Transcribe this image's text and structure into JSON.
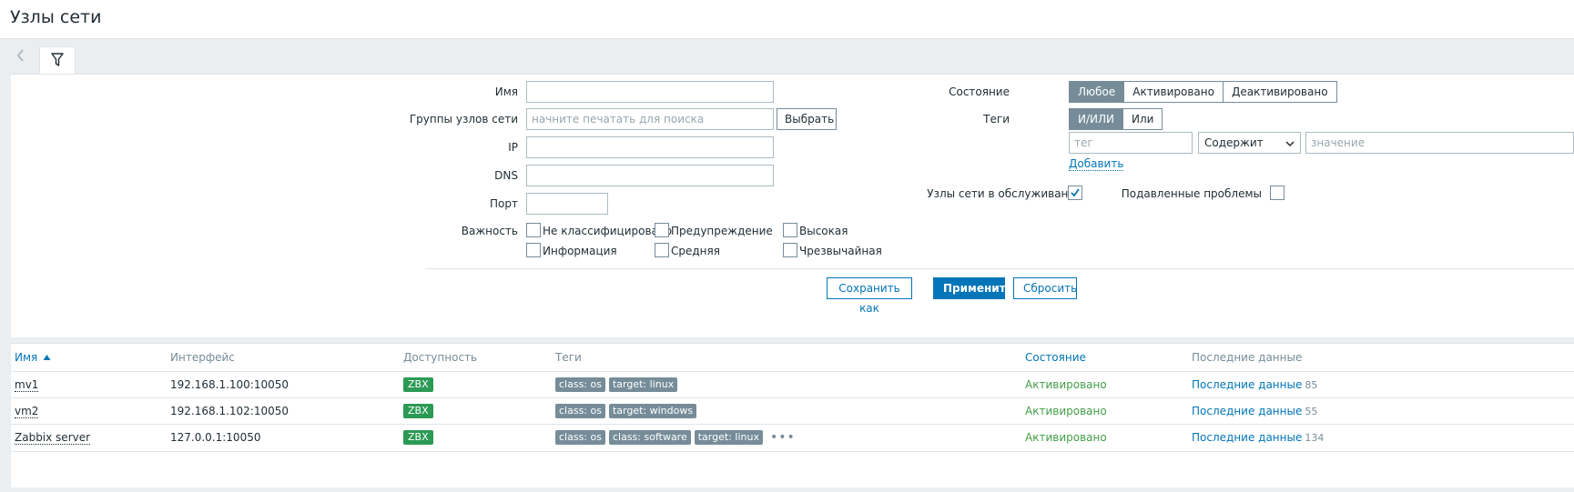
{
  "page": {
    "title": "Узлы сети"
  },
  "filter": {
    "name": {
      "label": "Имя",
      "value": ""
    },
    "host_groups": {
      "label": "Группы узлов сети",
      "placeholder": "начните печатать для поиска",
      "select_label": "Выбрать"
    },
    "ip": {
      "label": "IP",
      "value": ""
    },
    "dns": {
      "label": "DNS",
      "value": ""
    },
    "port": {
      "label": "Порт",
      "value": ""
    },
    "severity": {
      "label": "Важность",
      "options": [
        "Не классифицировано",
        "Предупреждение",
        "Высокая",
        "Информация",
        "Средняя",
        "Чрезвычайная"
      ]
    },
    "status": {
      "label": "Состояние",
      "options": [
        "Любое",
        "Активировано",
        "Деактивировано"
      ],
      "selected": "Любое"
    },
    "tags": {
      "label": "Теги",
      "operators": [
        "И/ИЛИ",
        "Или"
      ],
      "selected": "И/ИЛИ",
      "tag_placeholder": "тег",
      "operator_value": "Содержит",
      "value_placeholder": "значение",
      "add_label": "Добавить"
    },
    "maintenance": {
      "label": "Узлы сети в обслуживании",
      "checked": true
    },
    "suppressed": {
      "label": "Подавленные проблемы",
      "checked": false
    },
    "buttons": {
      "save_as": "Сохранить как",
      "apply": "Применить",
      "reset": "Сбросить"
    }
  },
  "table": {
    "columns": [
      "Имя",
      "Интерфейс",
      "Доступность",
      "Теги",
      "Состояние",
      "Последние данные"
    ],
    "sort_column": "Имя",
    "sort_direction": "asc",
    "rows": [
      {
        "name": "mv1",
        "interface": "192.168.1.100:10050",
        "availability": "ZBX",
        "tags": [
          "class: os",
          "target: linux"
        ],
        "status": "Активировано",
        "latest_label": "Последние данные",
        "latest_count": "85"
      },
      {
        "name": "vm2",
        "interface": "192.168.1.102:10050",
        "availability": "ZBX",
        "tags": [
          "class: os",
          "target: windows"
        ],
        "status": "Активировано",
        "latest_label": "Последние данные",
        "latest_count": "55"
      },
      {
        "name": "Zabbix server",
        "interface": "127.0.0.1:10050",
        "availability": "ZBX",
        "tags": [
          "class: os",
          "class: software",
          "target: linux"
        ],
        "status": "Активировано",
        "latest_label": "Последние данные",
        "latest_count": "134",
        "more_tags": "•••"
      }
    ]
  },
  "icons": {
    "back": "chevron-left-icon",
    "filter": "filter-funnel-icon",
    "select_caret": "chevron-down-icon",
    "checkbox_checked": "check-icon",
    "sort": "sort-ascending-icon"
  },
  "colors": {
    "accent": "#0275b8",
    "segment_active": "#768d99",
    "status_enabled": "#429e47",
    "availability_zbx": "#2b9a54",
    "tag_bg": "#768d99"
  }
}
